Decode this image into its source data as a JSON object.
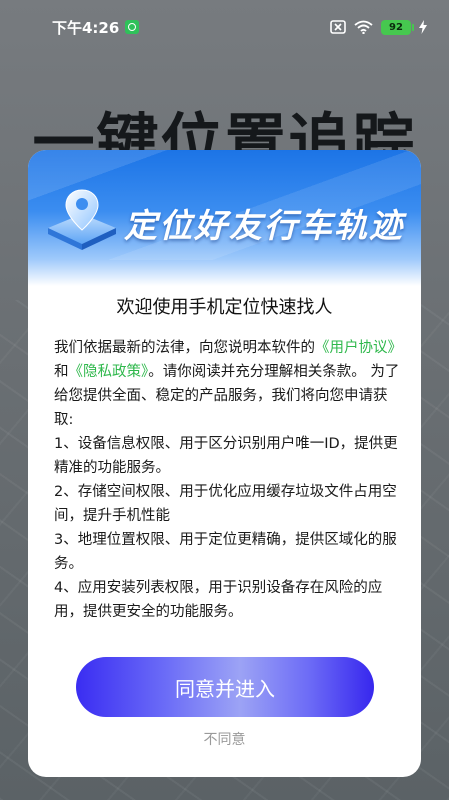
{
  "status_bar": {
    "time": "下午4:26",
    "battery": "92",
    "icons": [
      "app-notification-icon",
      "close-box-icon",
      "wifi-icon",
      "battery-icon",
      "charging-bolt-icon"
    ]
  },
  "background": {
    "title": "一键位置追踪"
  },
  "dialog": {
    "banner_title": "定位好友行车轨迹",
    "heading": "欢迎使用手机定位快速找人",
    "intro_prefix": "我们依据最新的法律，向您说明本软件的",
    "user_agreement": "《用户协议》",
    "and_text": "和",
    "privacy_policy": "《隐私政策》",
    "intro_suffix": "。请你阅读并充分理解相关条款。 为了给您提供全面、稳定的产品服务，我们将向您申请获取:",
    "permissions": [
      "1、设备信息权限、用于区分识别用户唯一ID，提供更精准的功能服务。",
      "2、存储空间权限、用于优化应用缓存垃圾文件占用空间，提升手机性能",
      "3、地理位置权限、用于定位更精确，提供区域化的服务。",
      "4、应用安装列表权限，用于识别设备存在风险的应用，提供更安全的功能服务。"
    ],
    "agree_label": "同意并进入",
    "decline_label": "不同意"
  },
  "colors": {
    "link": "#2fb84c",
    "button_primary": "#3a2df2",
    "banner_blue": "#1c74e6"
  }
}
